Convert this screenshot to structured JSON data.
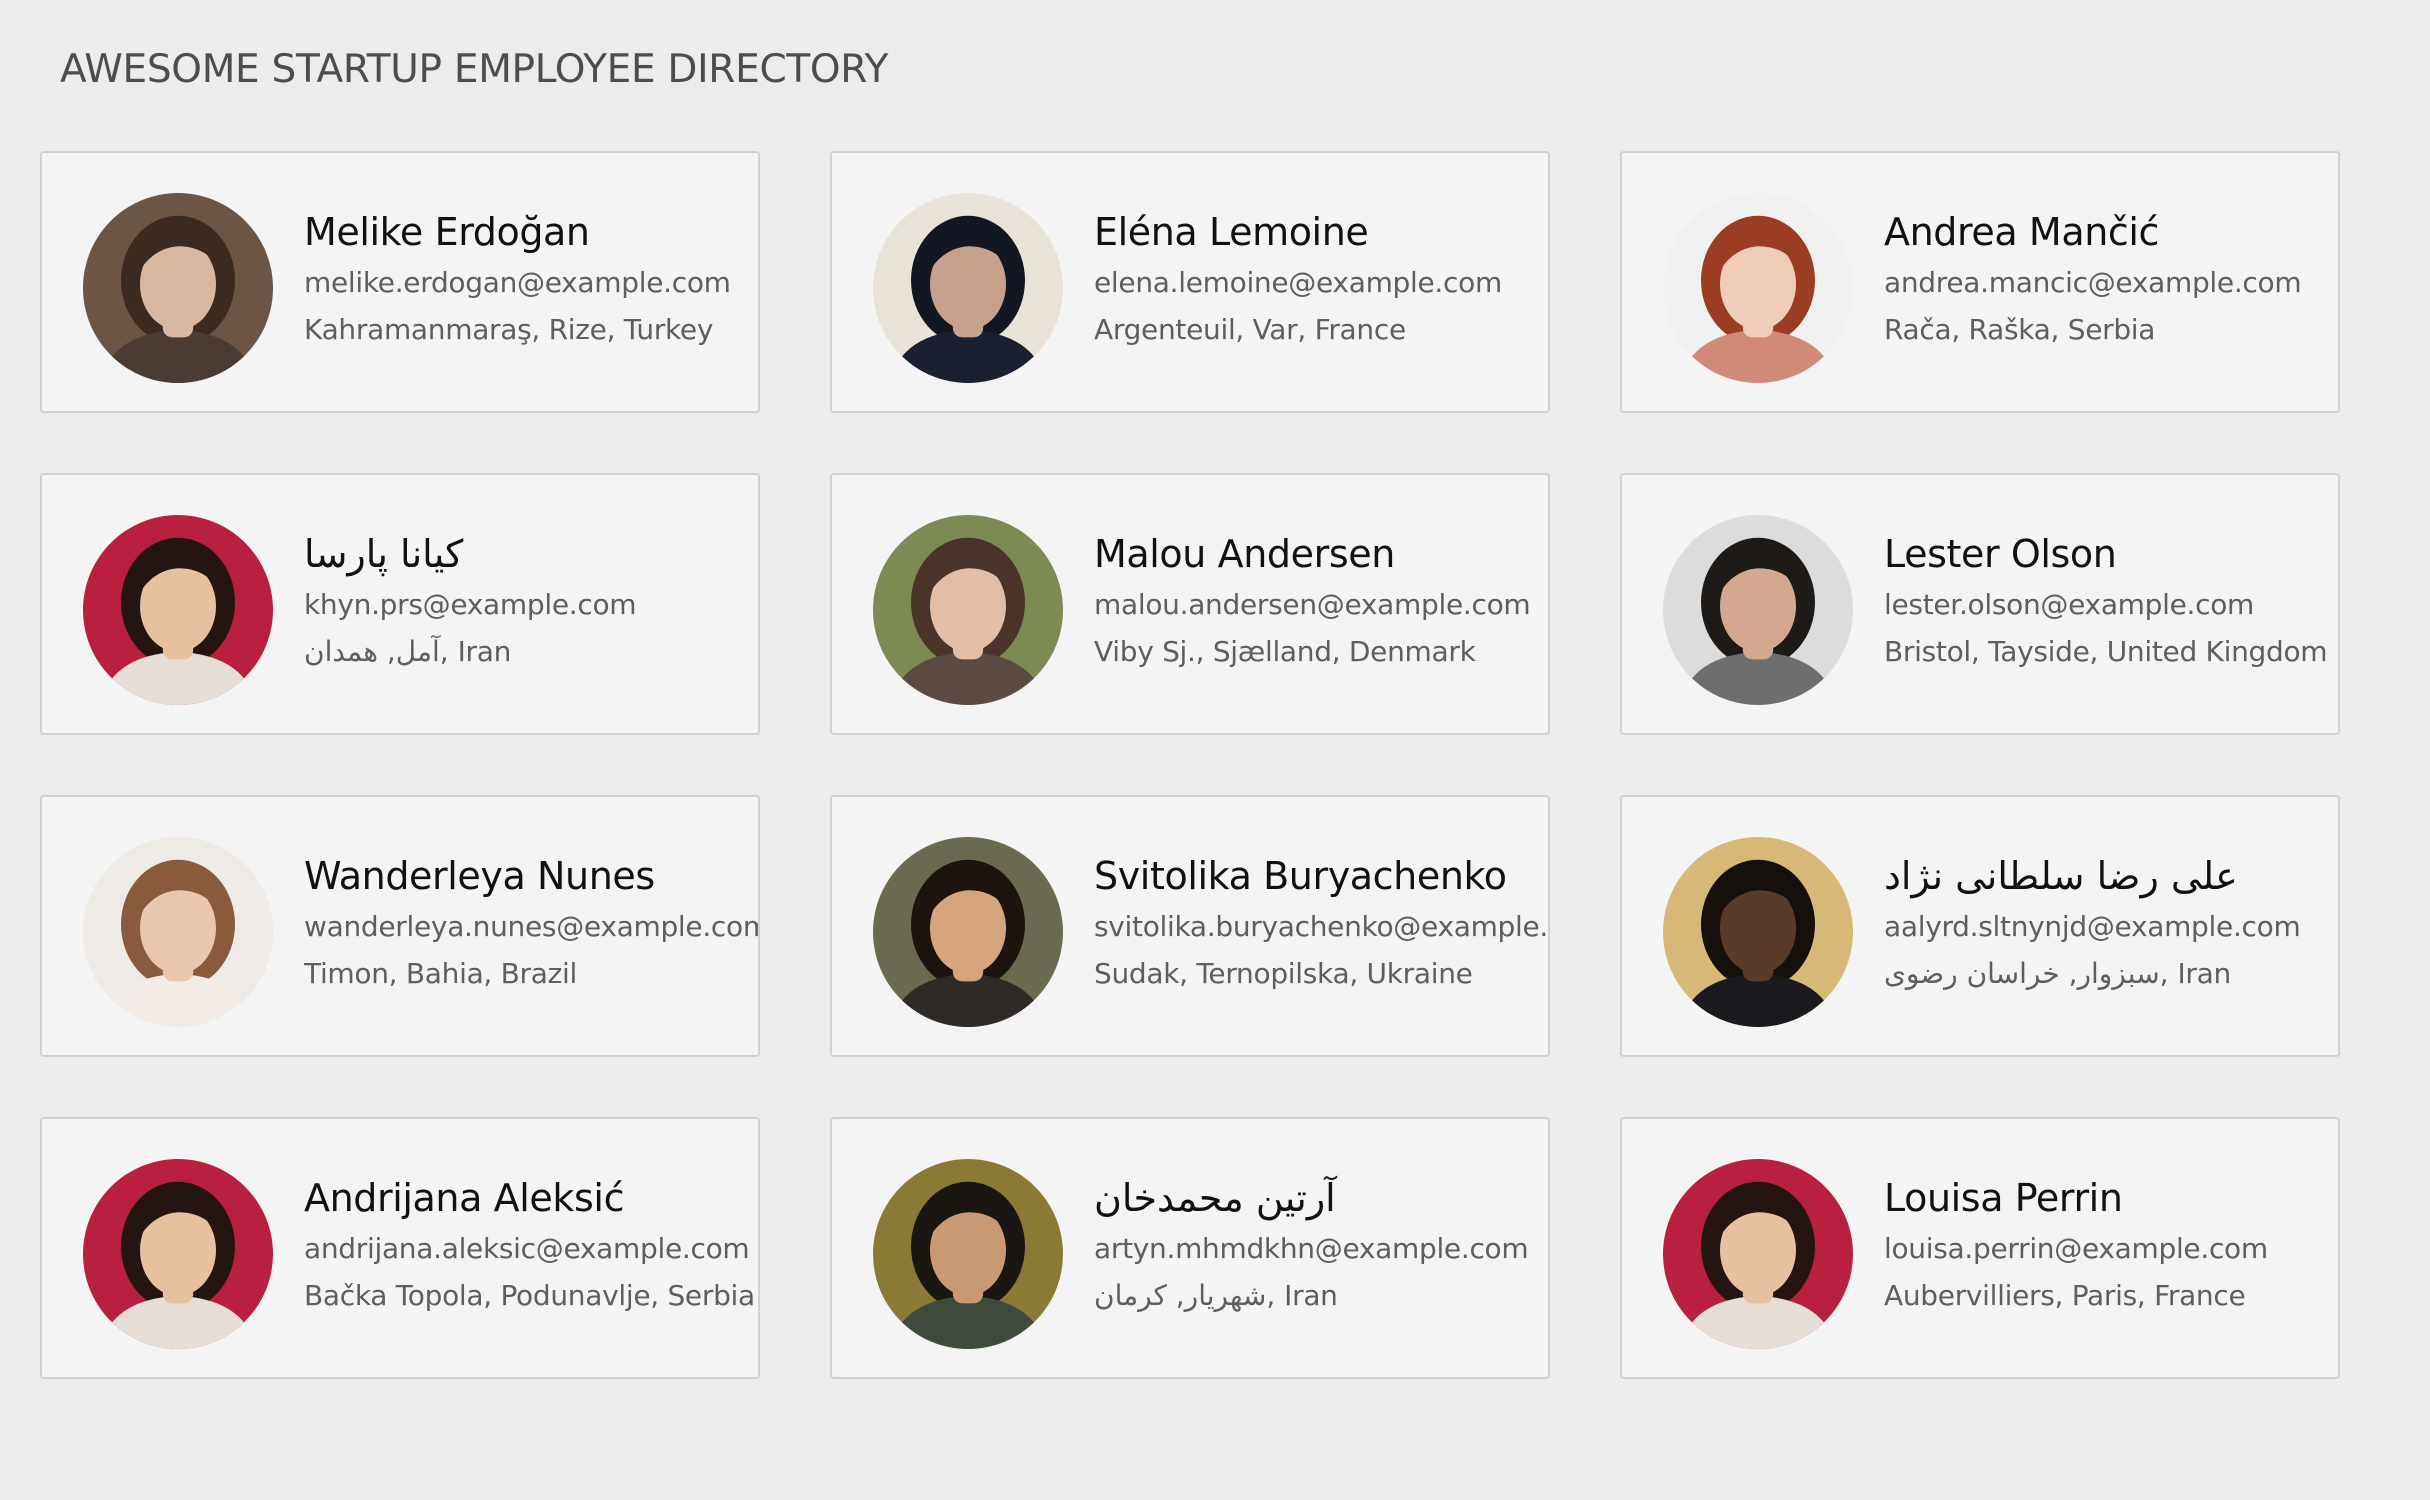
{
  "page": {
    "title": "AWESOME STARTUP EMPLOYEE DIRECTORY"
  },
  "employees": [
    {
      "name": "Melike Erdoğan",
      "email": "melike.erdogan@example.com",
      "location": "Kahramanmaraş, Rize, Turkey",
      "avatar": {
        "bg": "#6b5646",
        "skin": "#d9b8a2",
        "hair": "#3b2a20",
        "shirt": "#4a3c34"
      }
    },
    {
      "name": "Eléna Lemoine",
      "email": "elena.lemoine@example.com",
      "location": "Argenteuil, Var, France",
      "avatar": {
        "bg": "#e8e2d8",
        "skin": "#c7a18e",
        "hair": "#121722",
        "shirt": "#1b2030"
      }
    },
    {
      "name": "Andrea Mančić",
      "email": "andrea.mancic@example.com",
      "location": "Rača, Raška, Serbia",
      "avatar": {
        "bg": "#f0f0f0",
        "skin": "#efcdb8",
        "hair": "#9a3d22",
        "shirt": "#cf8b78"
      }
    },
    {
      "name": "كيانا پارسا",
      "email": "khyn.prs@example.com",
      "location": "آمل, همدان, Iran",
      "avatar": {
        "bg": "#b91f3e",
        "skin": "#e7c09f",
        "hair": "#241512",
        "shirt": "#e6ddd6"
      }
    },
    {
      "name": "Malou Andersen",
      "email": "malou.andersen@example.com",
      "location": "Viby Sj., Sjælland, Denmark",
      "avatar": {
        "bg": "#7d8a54",
        "skin": "#e3bda6",
        "hair": "#4a3328",
        "shirt": "#5b4a43"
      }
    },
    {
      "name": "Lester Olson",
      "email": "lester.olson@example.com",
      "location": "Bristol, Tayside, United Kingdom",
      "avatar": {
        "bg": "#dcdcdc",
        "skin": "#d3a88f",
        "hair": "#1e1a18",
        "shirt": "#6e6e6e"
      }
    },
    {
      "name": "Wanderleya Nunes",
      "email": "wanderleya.nunes@example.com",
      "location": "Timon, Bahia, Brazil",
      "avatar": {
        "bg": "#eeeae6",
        "skin": "#ebc6ae",
        "hair": "#8a5a3c",
        "shirt": "#f3ece6"
      }
    },
    {
      "name": "Svitolika Buryachenko",
      "email": "svitolika.buryachenko@example.com",
      "location": "Sudak, Ternopilska, Ukraine",
      "avatar": {
        "bg": "#6a6a50",
        "skin": "#d6a57e",
        "hair": "#1d1410",
        "shirt": "#2f2a28"
      }
    },
    {
      "name": "على رضا سلطانى نژاد",
      "email": "aalyrd.sltnynjd@example.com",
      "location": "سبزوار, خراسان رضوى, Iran",
      "avatar": {
        "bg": "#d8b876",
        "skin": "#5a3b2a",
        "hair": "#16100c",
        "shirt": "#1b1b1f"
      }
    },
    {
      "name": "Andrijana Aleksić",
      "email": "andrijana.aleksic@example.com",
      "location": "Bačka Topola, Podunavlje, Serbia",
      "avatar": {
        "bg": "#b91f3e",
        "skin": "#e7c09f",
        "hair": "#241512",
        "shirt": "#e6ddd6"
      }
    },
    {
      "name": "آرتين محمدخان",
      "email": "artyn.mhmdkhn@example.com",
      "location": "شهريار, كرمان, Iran",
      "avatar": {
        "bg": "#8b7a36",
        "skin": "#c99a74",
        "hair": "#1a1612",
        "shirt": "#3d4a3c"
      }
    },
    {
      "name": "Louisa Perrin",
      "email": "louisa.perrin@example.com",
      "location": "Aubervilliers, Paris, France",
      "avatar": {
        "bg": "#b91f3e",
        "skin": "#e7c09f",
        "hair": "#241512",
        "shirt": "#e6ddd6"
      }
    }
  ]
}
